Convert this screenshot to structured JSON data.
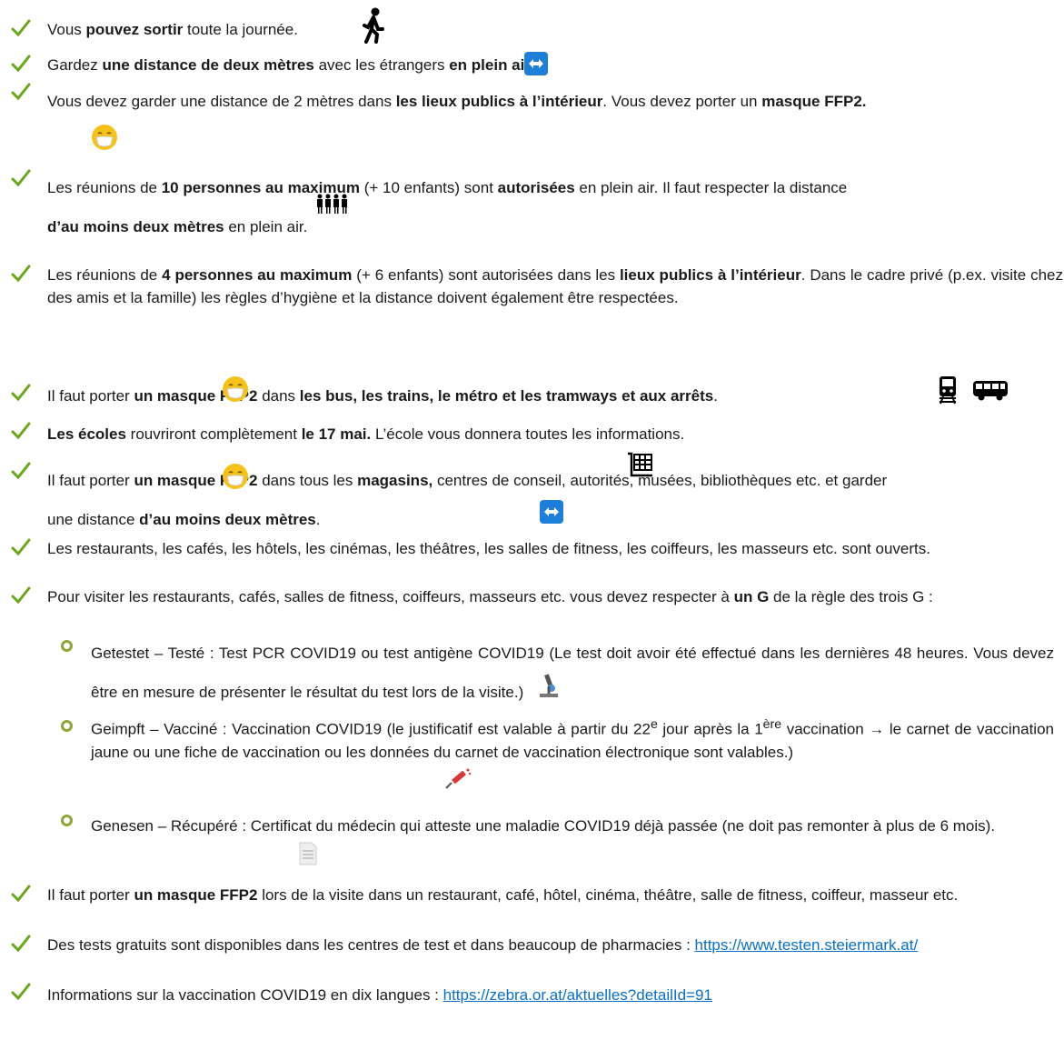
{
  "items": [
    {
      "key": "i1",
      "parts": [
        [
          "n",
          "Vous "
        ],
        [
          "b",
          "pouvez sortir"
        ],
        [
          "n",
          " toute la journée."
        ]
      ]
    },
    {
      "key": "i2",
      "parts": [
        [
          "n",
          "Gardez "
        ],
        [
          "b",
          "une distance de deux mètres"
        ],
        [
          "n",
          " avec les étrangers "
        ],
        [
          "b",
          "en plein air"
        ],
        [
          "n",
          "."
        ]
      ]
    },
    {
      "key": "i3",
      "parts": [
        [
          "n",
          "Vous devez garder une distance de 2 mètres dans "
        ],
        [
          "b",
          "les lieux publics à l’intérieur"
        ],
        [
          "n",
          ". Vous devez porter un "
        ],
        [
          "b",
          "masque FFP2."
        ]
      ]
    },
    {
      "key": "i4",
      "parts": [
        [
          "n",
          "Les réunions de "
        ],
        [
          "b",
          "10 personnes au maximum"
        ],
        [
          "n",
          " (+ 10 enfants) sont "
        ],
        [
          "b",
          "autorisées"
        ],
        [
          "n",
          " en plein air. Il faut respecter la distance "
        ],
        [
          "b",
          "d’au moins deux mètres"
        ],
        [
          "n",
          " en plein air."
        ]
      ]
    },
    {
      "key": "i5",
      "parts": [
        [
          "n",
          "Les réunions de "
        ],
        [
          "b",
          "4 personnes au maximum"
        ],
        [
          "n",
          " (+ 6 enfants) sont autorisées dans les "
        ],
        [
          "b",
          "lieux publics à l’intérieur"
        ],
        [
          "n",
          ". Dans le cadre privé (p.ex. visite chez des amis et la famille) les règles d’hygiène et la distance doivent également être respectées."
        ]
      ]
    },
    {
      "key": "i6",
      "parts": [
        [
          "n",
          "Il faut porter "
        ],
        [
          "b",
          "un masque FFP2"
        ],
        [
          "n",
          " dans "
        ],
        [
          "b",
          "les bus, les trains, le métro et les tramways et aux arrêts"
        ],
        [
          "n",
          "."
        ]
      ]
    },
    {
      "key": "i7",
      "parts": [
        [
          "b",
          "Les écoles"
        ],
        [
          "n",
          " rouvriront complètement "
        ],
        [
          "b",
          "le 17 mai."
        ],
        [
          "n",
          " L’école vous donnera toutes les informations."
        ]
      ]
    },
    {
      "key": "i8",
      "parts": [
        [
          "n",
          "Il faut porter "
        ],
        [
          "b",
          "un masque FFP2"
        ],
        [
          "n",
          " dans tous les "
        ],
        [
          "b",
          "magasins,"
        ],
        [
          "n",
          " centres de conseil, autorités, musées, bibliothèques etc. et garder une distance "
        ],
        [
          "b",
          "d’au moins deux mètres"
        ],
        [
          "n",
          "."
        ]
      ]
    },
    {
      "key": "i9",
      "parts": [
        [
          "n",
          "Les restaurants, les cafés, les hôtels, les cinémas, les théâtres, les salles de fitness, les coiffeurs, les masseurs etc. sont ouverts."
        ]
      ]
    },
    {
      "key": "i10",
      "parts": [
        [
          "n",
          "Pour visiter les restaurants, cafés, salles de fitness, coiffeurs, masseurs etc. vous devez respecter à "
        ],
        [
          "b",
          "un G"
        ],
        [
          "n",
          " de la règle des trois G :"
        ]
      ]
    },
    {
      "key": "s1",
      "parts": [
        [
          "n",
          "Getestet – Testé : Test PCR COVID19 ou test antigène COVID19 (Le test doit avoir été effectué dans les dernières 48 heures. Vous devez être en mesure de présenter le résultat du test lors de la visite.)"
        ]
      ]
    },
    {
      "key": "s2",
      "parts": [
        [
          "n",
          "Geimpft – Vacciné : Vaccination COVID19 (le justificatif est valable à partir du 22"
        ],
        [
          "sup",
          "e"
        ],
        [
          "n",
          " jour après la 1"
        ],
        [
          "sup",
          "ère"
        ],
        [
          "n",
          " vaccination → le carnet de vaccination jaune ou une fiche de vaccination ou les données du carnet de vaccination électronique sont valables.)"
        ]
      ]
    },
    {
      "key": "s3",
      "parts": [
        [
          "n",
          "Genesen – Récupéré : Certificat du médecin qui atteste une maladie COVID19 déjà passée (ne doit pas remonter à plus de 6 mois)."
        ]
      ]
    },
    {
      "key": "i11",
      "parts": [
        [
          "n",
          "Il faut porter "
        ],
        [
          "b",
          "un masque FFP2"
        ],
        [
          "n",
          " lors de la visite dans un restaurant, café, hôtel, cinéma, théâtre, salle de fitness, coiffeur, masseur etc."
        ]
      ]
    },
    {
      "key": "i12",
      "parts": [
        [
          "n",
          "Des tests gratuits sont disponibles dans les centres de test et dans beaucoup de pharmacies : "
        ],
        [
          "a",
          "https://www.testen.steiermark.at/"
        ]
      ]
    },
    {
      "key": "i13",
      "parts": [
        [
          "n",
          "Informations sur la vaccination COVID19 en dix langues : "
        ],
        [
          "a",
          "https://zebra.or.at/aktuelles?detailId=91"
        ]
      ]
    }
  ],
  "icons": [
    "walking-person-icon",
    "distance-arrows-icon",
    "mask-face-icon",
    "group-of-people-icon",
    "train-icon",
    "bus-icon",
    "shopping-cart-icon",
    "microscope-icon",
    "syringe-icon",
    "document-icon"
  ],
  "colors": {
    "tick": "#6aa51e",
    "bullet": "#8fa53a",
    "link": "#0b6fc2",
    "arrow_bg": "#1e7fd8",
    "mask": "#f4c21a"
  }
}
